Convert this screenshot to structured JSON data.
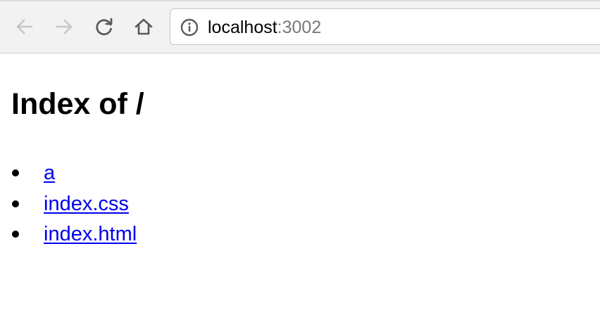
{
  "browser": {
    "url_host": "localhost",
    "url_port": ":3002",
    "icons": {
      "back": "arrow-left-icon",
      "forward": "arrow-right-icon",
      "reload": "reload-icon",
      "home": "home-icon",
      "info": "info-icon"
    },
    "colors": {
      "toolbar_bg": "#f2f2f2",
      "icon_disabled": "#c6c6c6",
      "icon_active": "#5a5a5a",
      "url_port": "#7a7a7a"
    }
  },
  "page": {
    "heading": "Index of /",
    "files": [
      {
        "name": "a"
      },
      {
        "name": "index.css"
      },
      {
        "name": "index.html"
      }
    ],
    "colors": {
      "link": "#0000ee"
    }
  }
}
